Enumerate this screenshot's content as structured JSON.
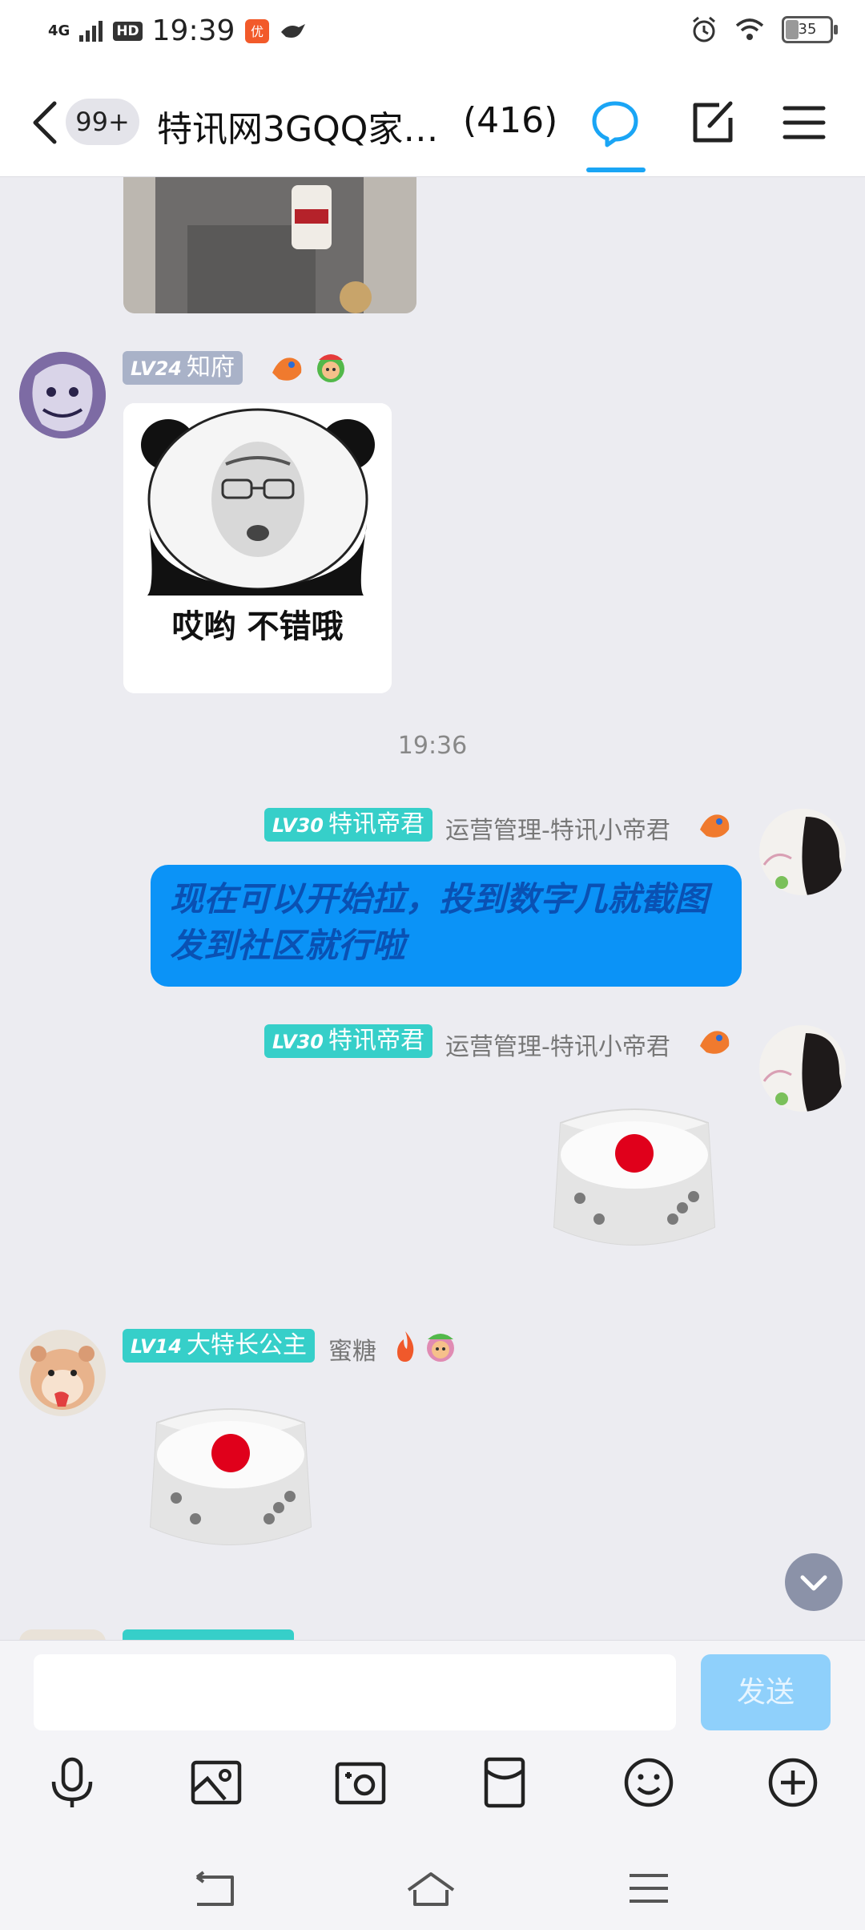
{
  "status_bar": {
    "network": "4G",
    "hd": "HD",
    "time": "19:39",
    "battery": "35"
  },
  "header": {
    "unread_badge": "99+",
    "title": "特讯网3GQQ家…",
    "member_count": "(416)",
    "accent_color": "#1aa5f5"
  },
  "messages": [
    {
      "type": "image",
      "sender_level": "LV24",
      "sender_title": "知府",
      "image_caption": "哎哟 不错哦"
    },
    {
      "type": "timestamp",
      "text": "19:36"
    },
    {
      "type": "text",
      "sender_level": "LV30",
      "sender_title": "特讯帝君",
      "sender_name": "运营管理-特讯小帝君",
      "text": "现在可以开始拉，投到数字几就截图发到社区就行啦"
    },
    {
      "type": "dice",
      "sender_level": "LV30",
      "sender_title": "特讯帝君",
      "sender_name": "运营管理-特讯小帝君",
      "dice_value": 1
    },
    {
      "type": "dice",
      "sender_level": "LV14",
      "sender_title": "大特长公主",
      "sender_name": "蜜糖",
      "dice_value": 1
    }
  ],
  "composer": {
    "send_label": "发送",
    "tools": [
      "microphone-icon",
      "image-icon",
      "camera-icon",
      "red-packet-icon",
      "emoji-icon",
      "plus-icon"
    ]
  },
  "colors": {
    "level_badge_teal": "#36cfc9",
    "level_badge_gray": "#a9b2c8",
    "bubble_blue": "#0b93f7",
    "dice_pip_red": "#e0001b"
  }
}
